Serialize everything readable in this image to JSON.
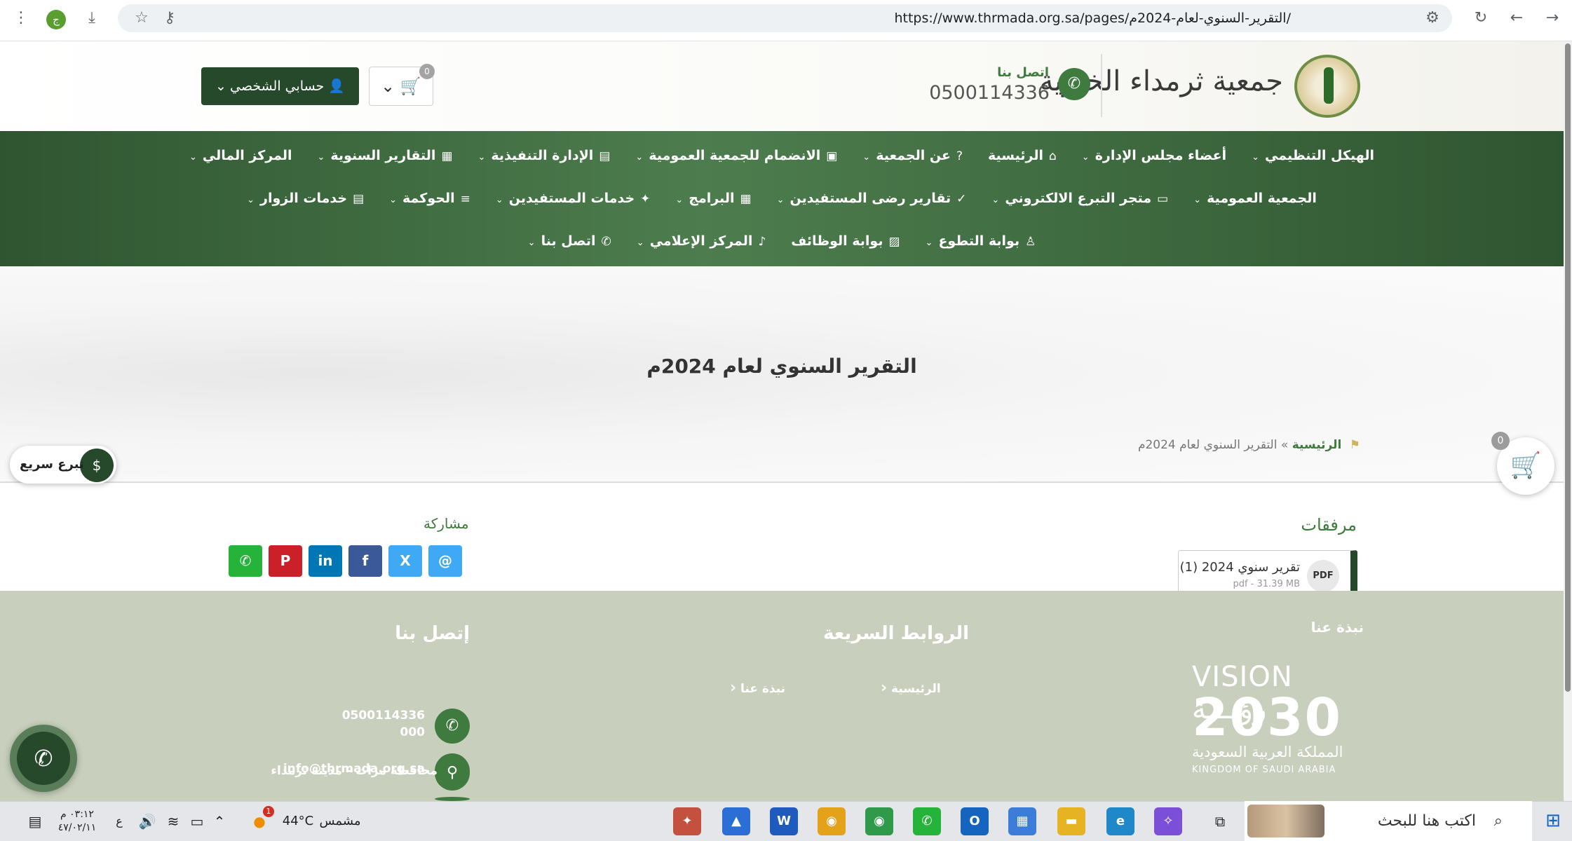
{
  "browser": {
    "url": "https://www.thrmada.org.sa/pages/التقرير-السنوي-لعام-2024م/",
    "extension_badge": "ج"
  },
  "header": {
    "logo_text": "جمعية ثرمداء الخيرية",
    "call_label": "اتصل بنا",
    "call_number": "0500114336",
    "cart_count": "0",
    "account_label": "حسابي الشخصي"
  },
  "nav": {
    "row1": [
      {
        "label": "الهيكل التنظيمي",
        "icon": "",
        "chev": true
      },
      {
        "label": "أعضاء مجلس الإدارة",
        "icon": "",
        "chev": true
      },
      {
        "label": "الرئيسية",
        "icon": "⌂",
        "chev": false
      },
      {
        "label": "عن الجمعية",
        "icon": "?",
        "chev": true
      },
      {
        "label": "الانضمام للجمعية العمومية",
        "icon": "▣",
        "chev": true
      },
      {
        "label": "الإدارة التنفيذية",
        "icon": "▤",
        "chev": true
      },
      {
        "label": "التقارير السنوية",
        "icon": "▦",
        "chev": true
      },
      {
        "label": "المركز المالي",
        "icon": "",
        "chev": true
      }
    ],
    "row2": [
      {
        "label": "الجمعية العمومية",
        "icon": "",
        "chev": true
      },
      {
        "label": "متجر التبرع الالكتروني",
        "icon": "▭",
        "chev": true
      },
      {
        "label": "تقارير رضى المستفيدين",
        "icon": "✓",
        "chev": true
      },
      {
        "label": "البرامج",
        "icon": "▦",
        "chev": true
      },
      {
        "label": "خدمات المستفيدين",
        "icon": "✦",
        "chev": true
      },
      {
        "label": "الحوكمة",
        "icon": "≡",
        "chev": true
      },
      {
        "label": "خدمات الزوار",
        "icon": "▤",
        "chev": true
      }
    ],
    "row3": [
      {
        "label": "بوابة التطوع",
        "icon": "♙",
        "chev": true
      },
      {
        "label": "بوابة الوظائف",
        "icon": "▨",
        "chev": false
      },
      {
        "label": "المركز الإعلامي",
        "icon": "♪",
        "chev": true
      },
      {
        "label": "اتصل بنا",
        "icon": "✆",
        "chev": true
      }
    ]
  },
  "hero": {
    "title": "التقرير السنوي لعام 2024م",
    "breadcrumb_home": "الرئيسية",
    "breadcrumb_sep": "»",
    "breadcrumb_current": "التقرير السنوي لعام 2024م"
  },
  "floating": {
    "cart_count": "0",
    "quick_donate": "تبرع سريع"
  },
  "attachments": {
    "title": "مرفقات",
    "file_name": "تقرير سنوي 2024 (1)",
    "file_meta": "pdf - 31.39 MB",
    "file_icon": "PDF"
  },
  "share": {
    "title": "مشاركة",
    "buttons": [
      {
        "name": "email-share",
        "glyph": "@",
        "color": "#3fa9f5"
      },
      {
        "name": "x-share",
        "glyph": "X",
        "color": "#3fa9f5"
      },
      {
        "name": "facebook-share",
        "glyph": "f",
        "color": "#3b5998"
      },
      {
        "name": "linkedin-share",
        "glyph": "in",
        "color": "#0077b5"
      },
      {
        "name": "pinterest-share",
        "glyph": "P",
        "color": "#cb2027"
      },
      {
        "name": "whatsapp-share",
        "glyph": "✆",
        "color": "#25b33a"
      }
    ]
  },
  "footer": {
    "about_title": "نبذة عنا",
    "vision_top": "VISION رؤيـــة",
    "vision_year": "2030",
    "vision_ar": "المملكة العربية السعودية",
    "vision_en": "KINGDOM OF SAUDI ARABIA",
    "links_title": "الروابط السريعة",
    "link_home": "الرئيسية",
    "link_about": "نبذة عنا",
    "contact_title": "إتصل بنا",
    "phone_line1": "0500114336",
    "phone_line2": "000",
    "email": "info@thrmada.org.sa",
    "address": "محافظة مرات - مدينة ثرمداء"
  },
  "taskbar": {
    "search_placeholder": "اكتب هنا للبحث",
    "weather_temp": "44°C",
    "weather_label": "مشمس",
    "weather_badge": "1",
    "lang": "ع",
    "time": "٠٣:١٢ م",
    "date": "٤٧/٠٢/١١"
  }
}
